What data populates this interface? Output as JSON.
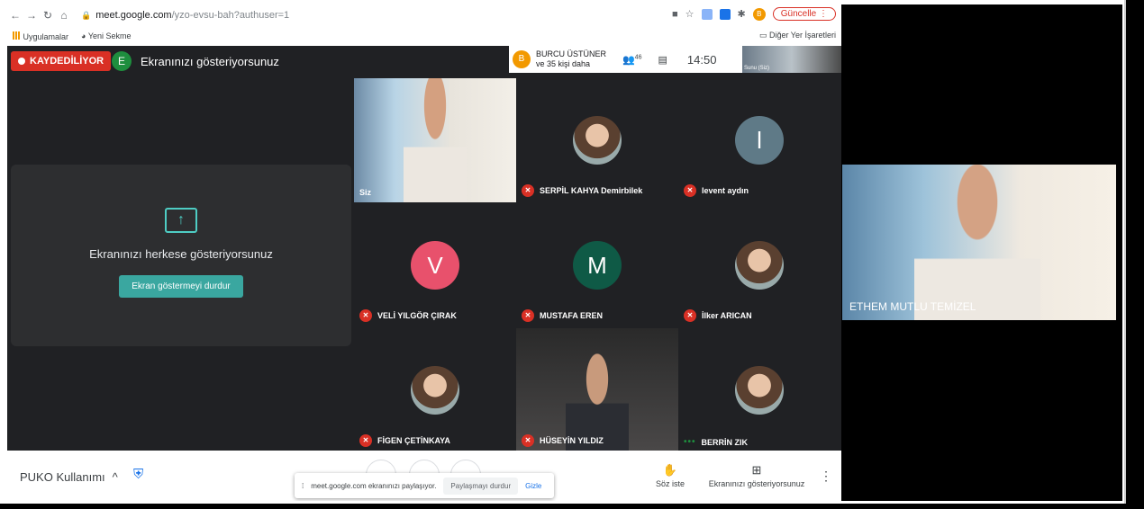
{
  "browser": {
    "url_host": "meet.google.com",
    "url_path": "/yzo-evsu-bah?authuser=1",
    "update_label": "Güncelle",
    "profile_initial": "B",
    "bookmarks": [
      "Uygulamalar",
      "Yeni Sekme"
    ],
    "other_bookmarks": "Diğer Yer İşaretleri"
  },
  "meet": {
    "recording_label": "KAYDEDİLİYOR",
    "presenter_initial": "E",
    "presenting_label": "Ekranınızı gösteriyorsunuz",
    "participants_initial": "B",
    "participants_line1": "BURCU ÜSTÜNER",
    "participants_line2": "ve 35 kişi daha",
    "people_count": "46",
    "clock": "14:50",
    "thumb_label": "Sunu (Siz)",
    "share_panel": {
      "title": "Ekranınızı herkese gösteriyorsunuz",
      "stop_button": "Ekran göstermeyi durdur"
    },
    "tiles": [
      {
        "name": "Siz",
        "kind": "camera"
      },
      {
        "name": "SERPİL KAHYA Demirbilek",
        "kind": "photo"
      },
      {
        "name": "levent aydın",
        "kind": "letter",
        "letter": "l",
        "color": "#5f7a87"
      },
      {
        "name": "VELİ YILGÖR ÇIRAK",
        "kind": "letter",
        "letter": "V",
        "color": "#e8516c"
      },
      {
        "name": "MUSTAFA EREN",
        "kind": "letter",
        "letter": "M",
        "color": "#0f5a46"
      },
      {
        "name": "İlker ARICAN",
        "kind": "photo"
      },
      {
        "name": "FİGEN ÇETİNKAYA",
        "kind": "photo"
      },
      {
        "name": "HÜSEYİN YILDIZ",
        "kind": "camera-dark"
      },
      {
        "name": "BERRİN ZIK",
        "kind": "photo"
      }
    ],
    "side_video_name": "ETHEM MUTLU TEMİZEL"
  },
  "bottombar": {
    "meeting_title": "PUKO Kullanımı",
    "raise_hand": "Söz iste",
    "presenting": "Ekranınızı gösteriyorsunuz"
  },
  "sharing_banner": {
    "text": "meet.google.com ekranınızı paylaşıyor.",
    "stop": "Paylaşmayı durdur",
    "hide": "Gizle"
  }
}
